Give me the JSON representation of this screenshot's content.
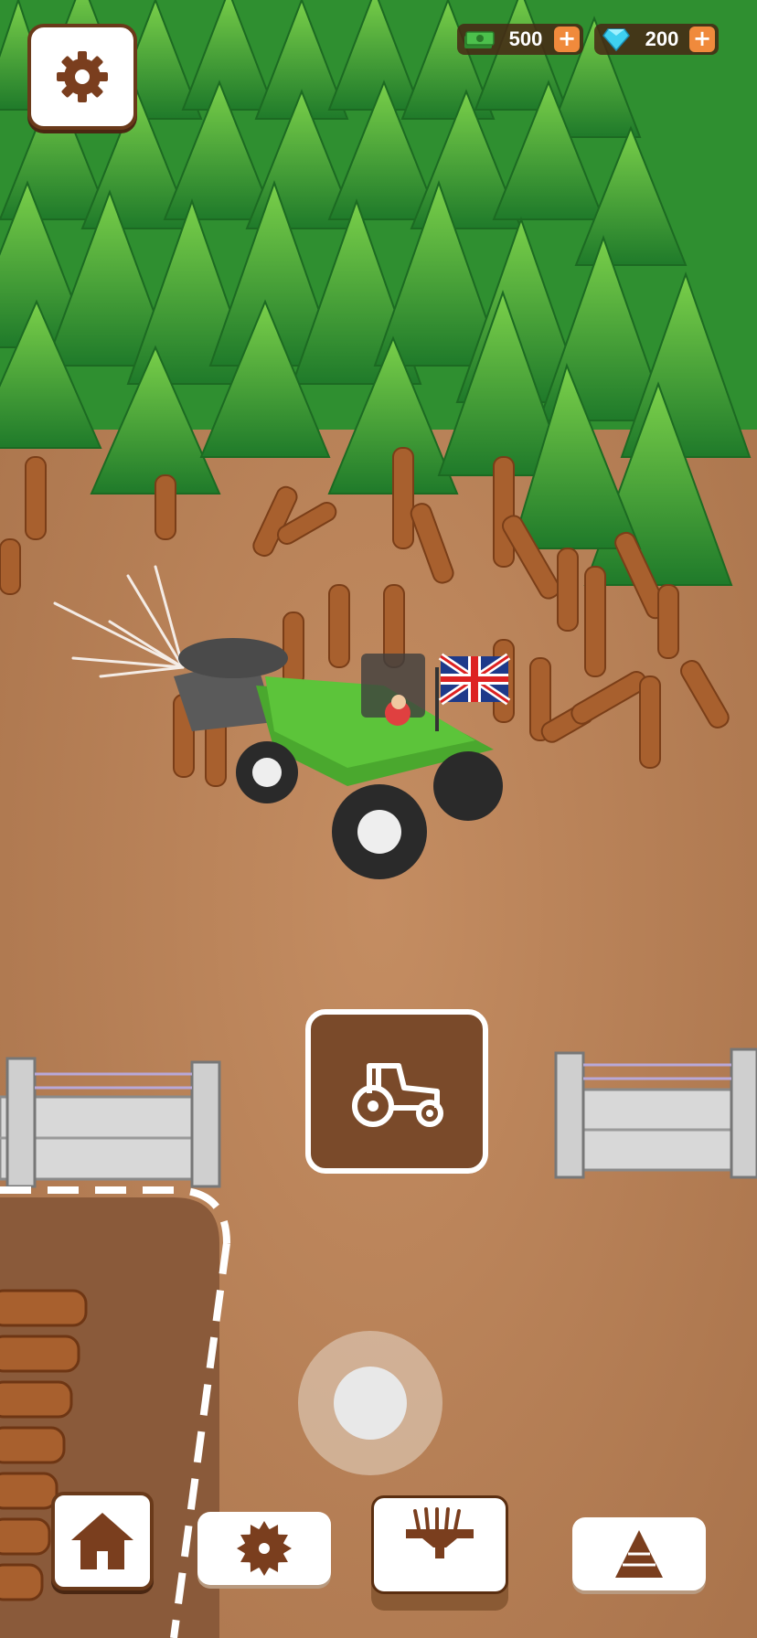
{
  "hud": {
    "cash": {
      "value": "500",
      "icon": "cash-bills-icon",
      "add_icon": "plus-icon"
    },
    "gems": {
      "value": "200",
      "icon": "diamond-icon",
      "add_icon": "plus-icon"
    },
    "settings_icon": "gear-icon"
  },
  "zone": {
    "icon": "tractor-icon"
  },
  "joystick": {
    "icon": "joystick"
  },
  "bottom_bar": [
    {
      "icon": "home-icon"
    },
    {
      "icon": "saw-blade-icon"
    },
    {
      "icon": "log-processor-icon"
    },
    {
      "icon": "log-pile-icon"
    }
  ],
  "colors": {
    "ground": "#b9825a",
    "foliage": "#3fae34",
    "tractor": "#5cc43a",
    "ui_brown": "#6a3a1a",
    "accent_orange": "#f08a3c",
    "gem_cyan": "#3fd0f0"
  }
}
